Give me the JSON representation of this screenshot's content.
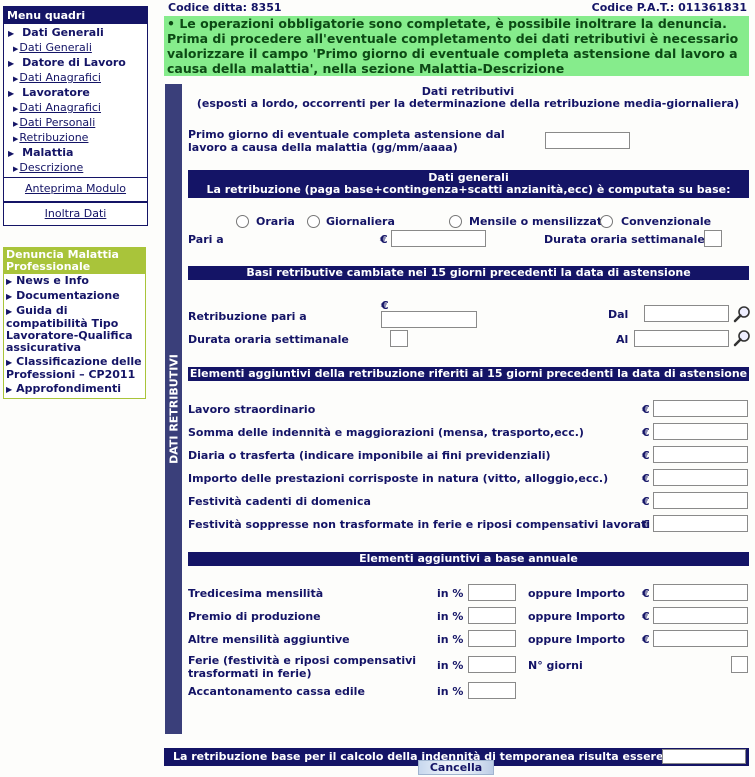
{
  "menu": {
    "title": "Menu quadri",
    "sections": [
      {
        "label": "Dati Generali",
        "links": [
          "Dati Generali"
        ]
      },
      {
        "label": "Datore di Lavoro",
        "links": [
          "Dati Anagrafici"
        ]
      },
      {
        "label": "Lavoratore",
        "links": [
          "Dati Anagrafici",
          "Dati Personali",
          "Retribuzione"
        ]
      },
      {
        "label": "Malattia",
        "links": [
          "Descrizione"
        ]
      }
    ],
    "anteprima": "Anteprima Modulo",
    "inoltra": "Inoltra Dati"
  },
  "denuncia": {
    "title": "Denuncia Malattia Professionale",
    "items": [
      "News e Info",
      "Documentazione",
      "Guida di compatibilità Tipo Lavoratore-Qualifica assicurativa",
      "Classificazione delle Professioni – CP2011",
      "Approfondimenti"
    ]
  },
  "header": {
    "codice_ditta": "Codice ditta: 8351",
    "codice_pat": "Codice P.A.T.: 011361831"
  },
  "notice": "• Le operazioni obbligatorie sono completate, è possibile inoltrare la denuncia. Prima di procedere all'eventuale completamento dei dati retributivi è necessario valorizzare il campo 'Primo giorno di eventuale completa astensione dal lavoro a causa della malattia', nella sezione Malattia-Descrizione",
  "vertical_label": "DATI RETRIBUTIVI",
  "form": {
    "title": "Dati retributivi",
    "subtitle": "(esposti a lordo, occorrenti per la determinazione della retribuzione media-giornaliera)",
    "primo_giorno_label": "Primo giorno di eventuale completa astensione dal lavoro a causa della malattia (gg/mm/aaaa)",
    "primo_giorno_value": "",
    "dati_generali": {
      "title": "Dati generali",
      "subtitle": "La retribuzione (paga base+contingenza+scatti anzianità,ecc) è computata su base:",
      "radios": [
        "Oraria",
        "Giornaliera",
        "Mensile o mensilizzata",
        "Convenzionale"
      ],
      "pari_a": "Pari a",
      "euro": "€",
      "durata": "Durata oraria settimanale"
    },
    "basi": {
      "title": "Basi retributive cambiate nei 15 giorni precedenti la data di astensione",
      "euro": "€",
      "retribuzione": "Retribuzione pari a",
      "durata": "Durata oraria settimanale",
      "dal": "Dal",
      "al": "Al"
    },
    "elementi15": {
      "title": "Elementi aggiuntivi della retribuzione riferiti ai 15 giorni precedenti la data di astensione",
      "euro": "€",
      "rows": [
        "Lavoro straordinario",
        "Somma delle indennità e maggiorazioni (mensa, trasporto,ecc.)",
        "Diaria o trasferta (indicare imponibile ai fini previdenziali)",
        "Importo delle prestazioni corrisposte in natura (vitto, alloggio,ecc.)",
        "Festività cadenti di domenica",
        "Festività soppresse non trasformate in ferie e riposi compensativi lavorati"
      ]
    },
    "annuale": {
      "title": "Elementi aggiuntivi a base annuale",
      "in_pct": "in %",
      "oppure": "oppure Importo",
      "euro": "€",
      "n_giorni": "N° giorni",
      "rows": [
        "Tredicesima mensilità",
        "Premio di produzione",
        "Altre mensilità aggiuntive",
        "Ferie (festività e riposi compensativi trasformati in ferie)",
        "Accantonamento cassa edile"
      ]
    },
    "footer_label": "La retribuzione base per il calcolo della indennità di temporanea risulta essere di €",
    "cancel": "Cancella"
  }
}
